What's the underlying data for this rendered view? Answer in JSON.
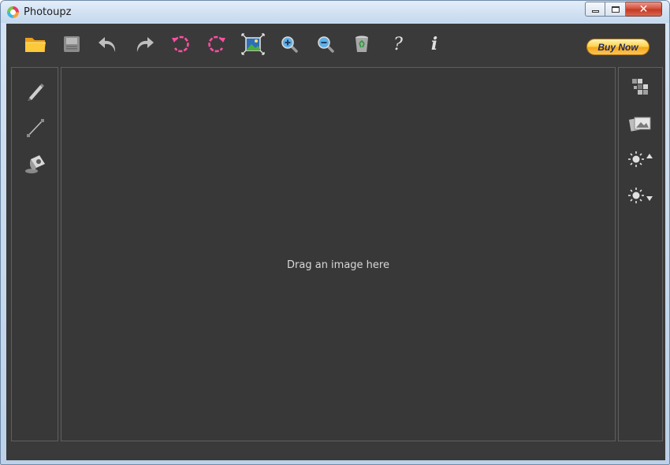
{
  "window": {
    "title": "Photoupz",
    "controls": {
      "minimize": "minimize-icon",
      "maximize": "maximize-icon",
      "close": "close-icon"
    }
  },
  "toolbar": {
    "tools": [
      {
        "name": "open",
        "icon": "folder-icon"
      },
      {
        "name": "save",
        "icon": "floppy-disk-icon"
      },
      {
        "name": "undo",
        "icon": "undo-arrow-icon"
      },
      {
        "name": "redo",
        "icon": "redo-arrow-icon"
      },
      {
        "name": "rotate-left",
        "icon": "rotate-left-icon"
      },
      {
        "name": "rotate-right",
        "icon": "rotate-right-icon"
      },
      {
        "name": "fit-to-window",
        "icon": "fit-image-icon"
      },
      {
        "name": "zoom-in",
        "icon": "zoom-in-icon"
      },
      {
        "name": "zoom-out",
        "icon": "zoom-out-icon"
      },
      {
        "name": "delete",
        "icon": "recycle-bin-icon"
      },
      {
        "name": "help",
        "icon": "question-mark-icon"
      },
      {
        "name": "info",
        "icon": "info-icon"
      }
    ],
    "help_glyph": "?",
    "info_glyph": "i",
    "buy_now_label": "Buy Now"
  },
  "left_tools": [
    {
      "name": "pencil",
      "icon": "pencil-icon"
    },
    {
      "name": "line",
      "icon": "line-icon"
    },
    {
      "name": "paint-bucket",
      "icon": "paint-bucket-icon"
    }
  ],
  "right_tools": [
    {
      "name": "mosaic",
      "icon": "mosaic-icon"
    },
    {
      "name": "photo-effect",
      "icon": "photos-icon"
    },
    {
      "name": "brightness-up",
      "icon": "brightness-up-icon"
    },
    {
      "name": "brightness-down",
      "icon": "brightness-down-icon"
    }
  ],
  "canvas": {
    "drop_hint": "Drag an image here"
  },
  "colors": {
    "app_background": "#3a3a3a",
    "panel_border": "#5f5f5f",
    "rotate_accent": "#ff4fa3",
    "buy_now": "#f6a818",
    "folder": "#f4b321"
  }
}
